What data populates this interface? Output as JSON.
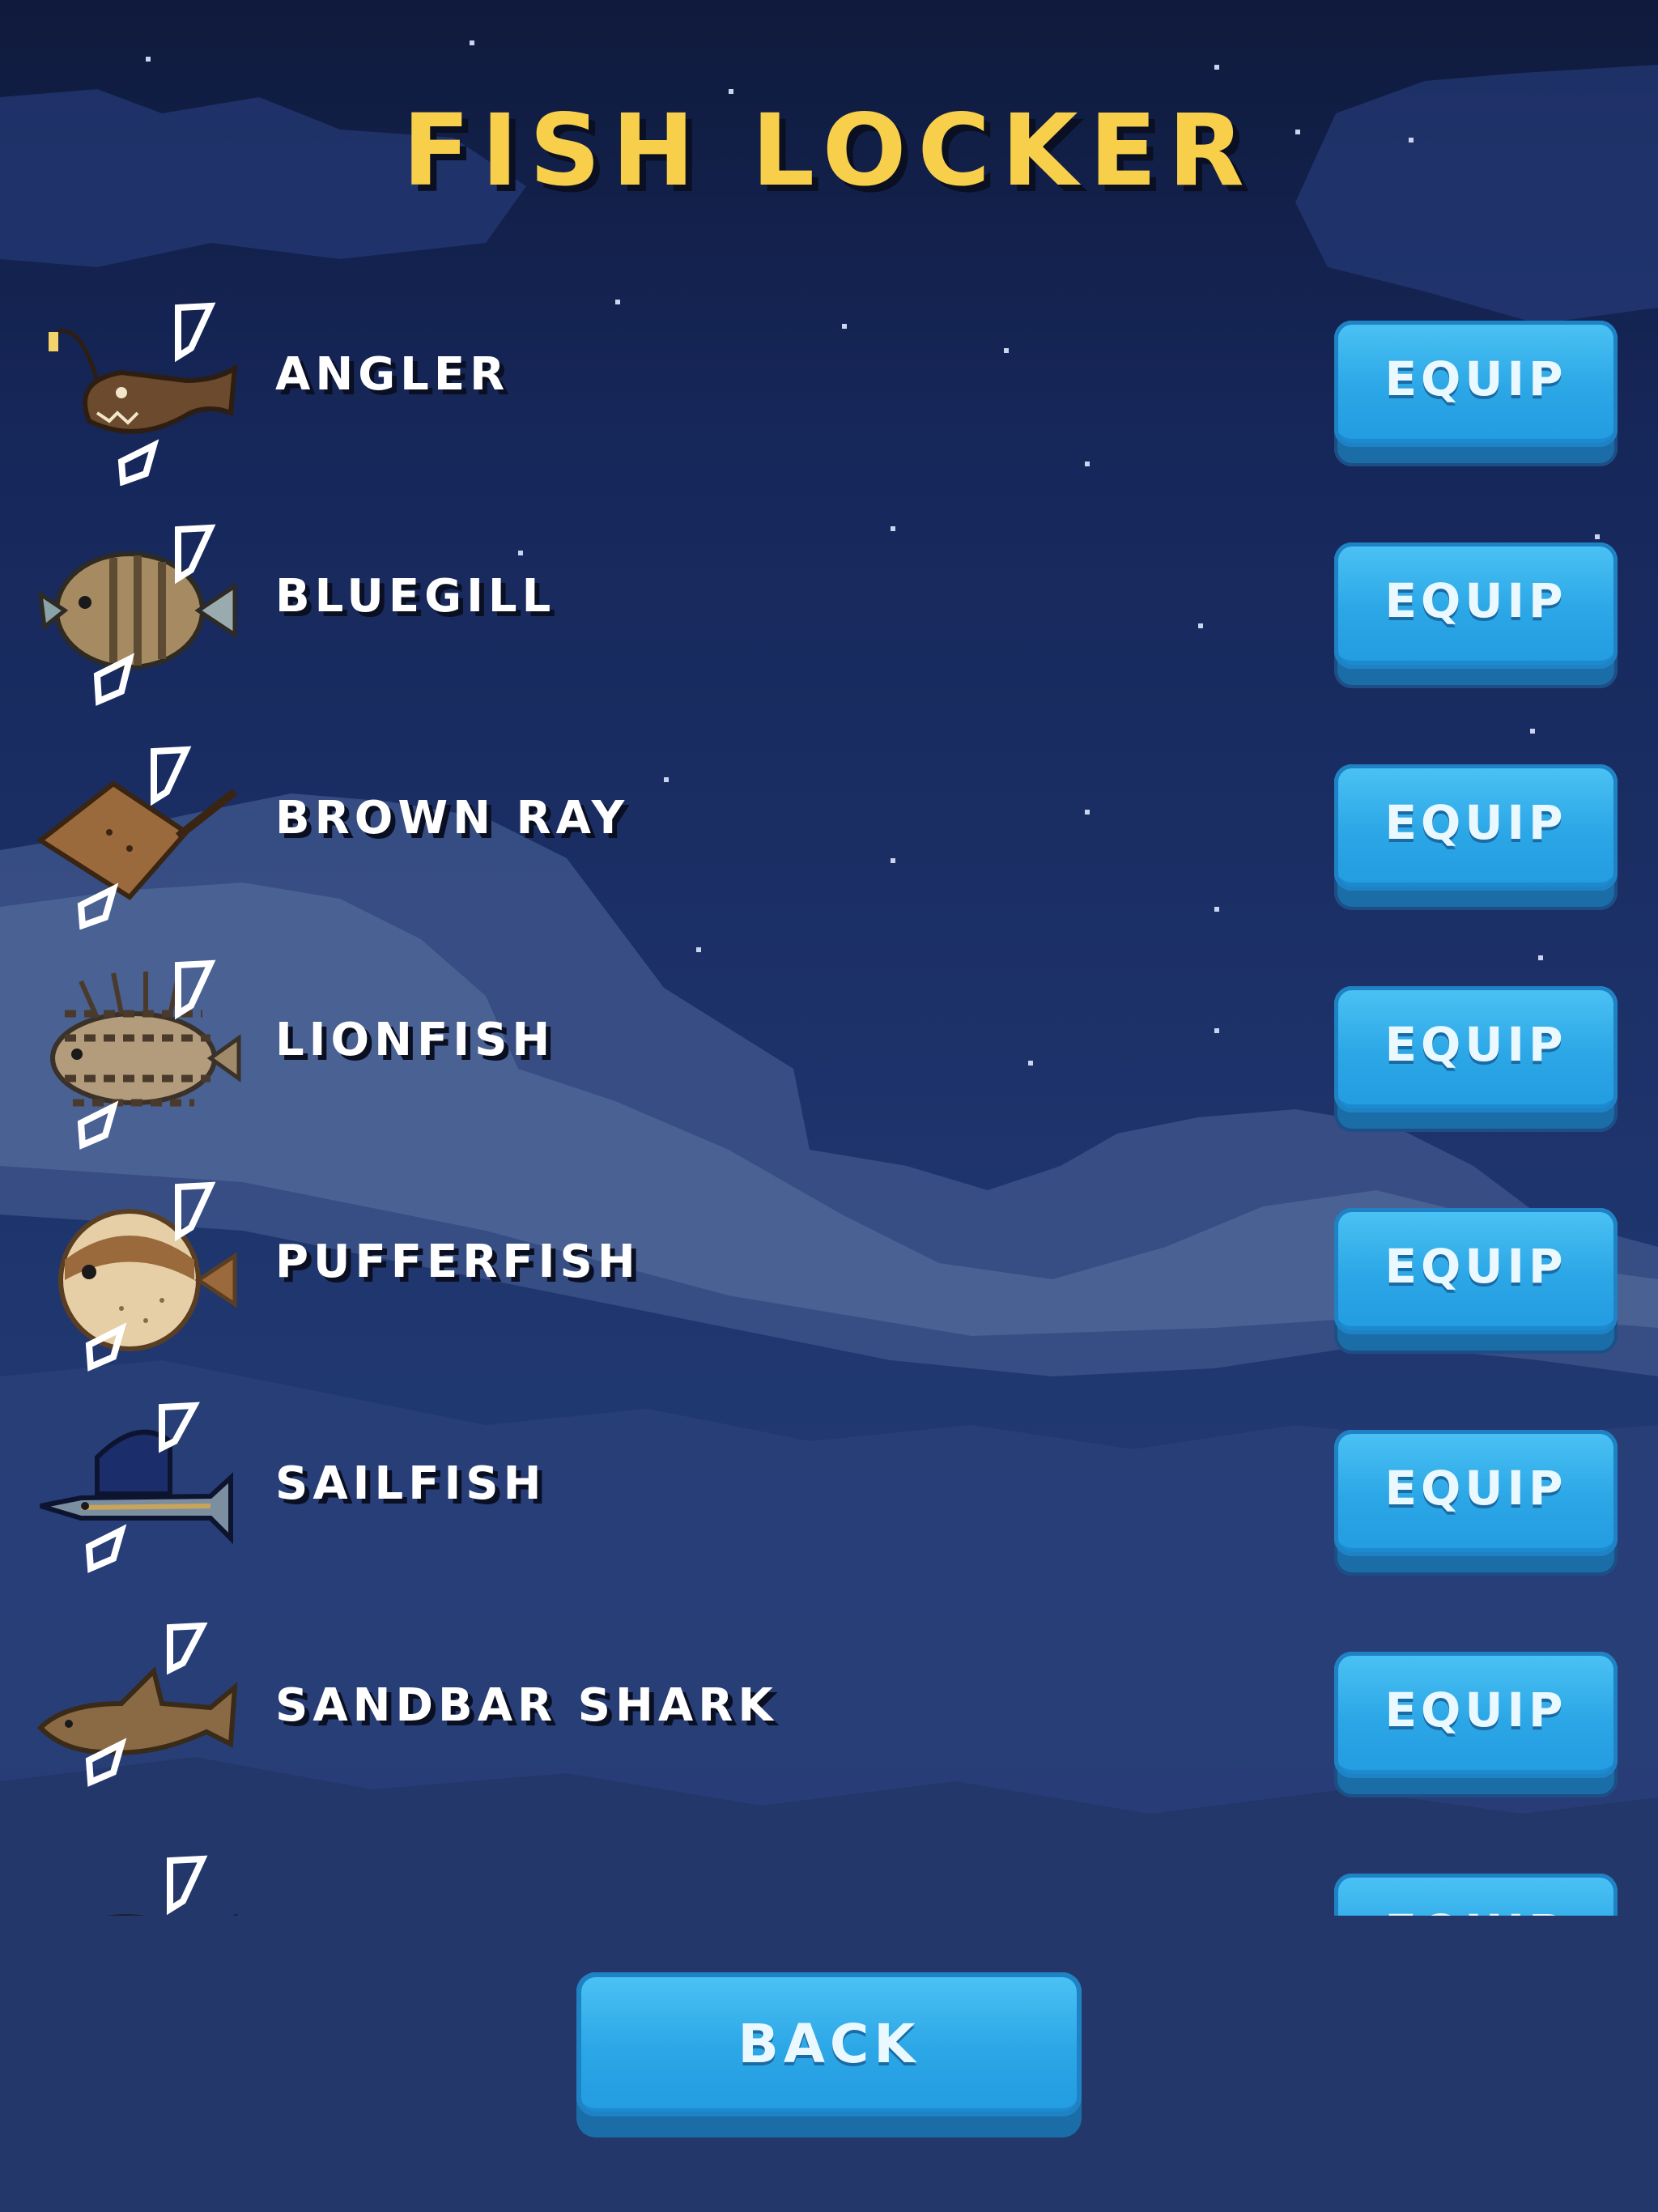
{
  "screen": {
    "title": "FISH LOCKER",
    "back_label": "BACK"
  },
  "fish": [
    {
      "name": "ANGLER",
      "action": "EQUIP",
      "icon": "angler-fish-icon"
    },
    {
      "name": "BLUEGILL",
      "action": "EQUIP",
      "icon": "bluegill-fish-icon"
    },
    {
      "name": "BROWN RAY",
      "action": "EQUIP",
      "icon": "brown-ray-fish-icon"
    },
    {
      "name": "LIONFISH",
      "action": "EQUIP",
      "icon": "lionfish-icon"
    },
    {
      "name": "PUFFERFISH",
      "action": "EQUIP",
      "icon": "pufferfish-icon"
    },
    {
      "name": "SAILFISH",
      "action": "EQUIP",
      "icon": "sailfish-icon"
    },
    {
      "name": "SANDBAR SHARK",
      "action": "EQUIP",
      "icon": "sandbar-shark-icon"
    },
    {
      "name": "",
      "action": "EQUIP",
      "icon": "fish-icon"
    }
  ],
  "colors": {
    "title": "#f7cf4a",
    "button": "#2ba6e6",
    "sky_top": "#0f1a3c",
    "cloud": "#4a5f90"
  }
}
